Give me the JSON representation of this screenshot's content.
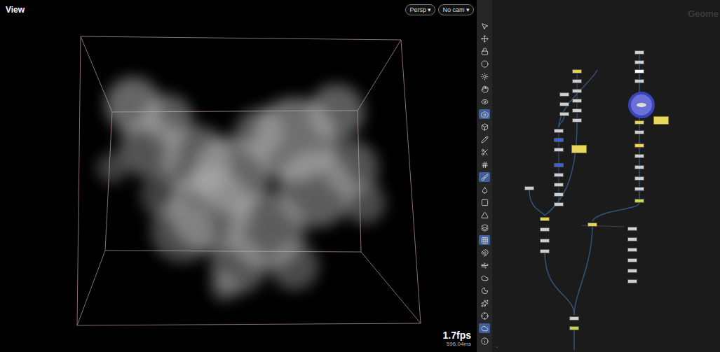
{
  "viewport": {
    "title": "View",
    "buttons": [
      {
        "label": "Persp ▾"
      },
      {
        "label": "No cam ▾"
      }
    ],
    "fps": "1.7fps",
    "time": "596.04ms"
  },
  "toolbar": {
    "tools": [
      {
        "selected": false
      },
      {
        "selected": false
      },
      {
        "selected": false
      },
      {
        "selected": false
      },
      {
        "selected": false
      },
      {
        "selected": false
      },
      {
        "selected": false
      },
      {
        "selected": true
      },
      {
        "selected": false
      },
      {
        "selected": false
      },
      {
        "selected": false
      },
      {
        "selected": false
      },
      {
        "selected": true
      },
      {
        "selected": false
      },
      {
        "selected": false
      },
      {
        "selected": false
      },
      {
        "selected": false
      },
      {
        "selected": true
      },
      {
        "selected": false
      },
      {
        "selected": false
      },
      {
        "selected": false
      },
      {
        "selected": false
      },
      {
        "selected": false
      },
      {
        "selected": false
      },
      {
        "selected": true
      },
      {
        "selected": false
      }
    ]
  },
  "network": {
    "title": "Geome",
    "nodes": [
      {
        "color": "#e8d44d"
      },
      {
        "color": "#cfcfcf"
      },
      {
        "color": "#cfcfcf"
      },
      {
        "color": "#cfcfcf"
      },
      {
        "color": "#cfcfcf"
      },
      {
        "color": "#cfcfcf"
      },
      {
        "color": "#cfcfcf"
      },
      {
        "color": "#cfcfcf"
      },
      {
        "color": "#cfcfcf"
      },
      {
        "color": "#cfcfcf"
      },
      {
        "color": "#3a5fd9"
      },
      {
        "color": "#cfcfcf"
      },
      {
        "color": "#3a5fd9"
      },
      {
        "color": "#cfcfcf"
      },
      {
        "color": "#cfcfcf"
      },
      {
        "color": "#cfcfcf"
      },
      {
        "color": "#cfcfcf"
      },
      {
        "color": "#cfcfcf"
      },
      {
        "color": "#e8d44d"
      },
      {
        "color": "#cfcfcf"
      },
      {
        "color": "#cfcfcf"
      },
      {
        "color": "#cfcfcf"
      },
      {
        "color": "#cfcfcf"
      },
      {
        "color": "#c6d84a"
      },
      {
        "color": "#cfcfcf"
      },
      {
        "color": "#cfcfcf"
      },
      {
        "color": "#ffffff"
      },
      {
        "color": "#cfcfcf"
      },
      {
        "color": "#e8d44d"
      },
      {
        "color": "#cfcfcf"
      },
      {
        "color": "#e8d44d"
      },
      {
        "color": "#cfcfcf"
      },
      {
        "color": "#cfcfcf"
      },
      {
        "color": "#cfcfcf"
      },
      {
        "color": "#cfcfcf"
      },
      {
        "color": "#c6d84a"
      },
      {
        "color": "#e8d44d"
      },
      {
        "color": "#cfcfcf"
      },
      {
        "color": "#cfcfcf"
      },
      {
        "color": "#cfcfcf"
      },
      {
        "color": "#cfcfcf"
      },
      {
        "color": "#cfcfcf"
      },
      {
        "color": "#cfcfcf"
      }
    ],
    "notes": [
      {
        "color": "#e8d860"
      },
      {
        "color": "#e8d860"
      }
    ]
  }
}
